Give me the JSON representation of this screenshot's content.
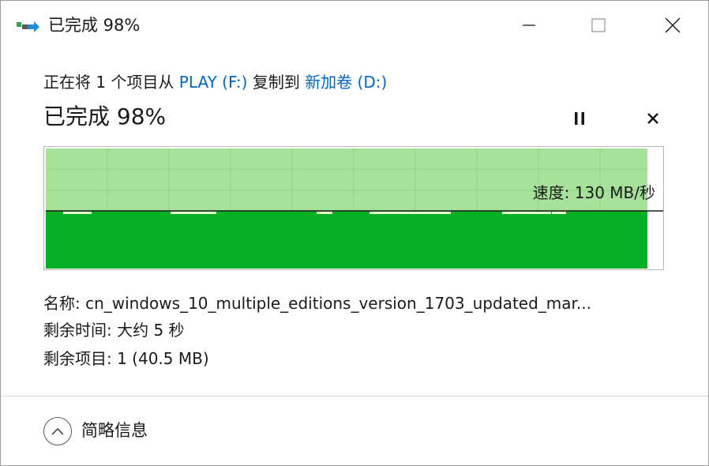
{
  "window": {
    "title": "已完成 98%",
    "icon": "file-copy-icon",
    "minimize_icon": "minimize-icon",
    "maximize_icon": "maximize-icon",
    "close_icon": "close-icon"
  },
  "copy": {
    "prefix": "正在将 1 个项目从 ",
    "source": "PLAY (F:)",
    "middle": " 复制到 ",
    "destination": "新加卷 (D:)",
    "progress_text": "已完成 98%",
    "progress_percent": 98,
    "pause_icon": "pause-icon",
    "cancel_icon": "cancel-icon"
  },
  "graph": {
    "speed_text": "速度: 130 MB/秒",
    "fill_color": "#06b025",
    "remaining_color": "#a6e29a",
    "grid_color": "#8fd480"
  },
  "details": {
    "name": "名称: cn_windows_10_multiple_editions_version_1703_updated_mar...",
    "time_remaining": "剩余时间: 大约 5 秒",
    "items_remaining": "剩余项目: 1 (40.5 MB)"
  },
  "footer": {
    "toggle_label": "简略信息",
    "toggle_icon": "chevron-up-icon"
  }
}
